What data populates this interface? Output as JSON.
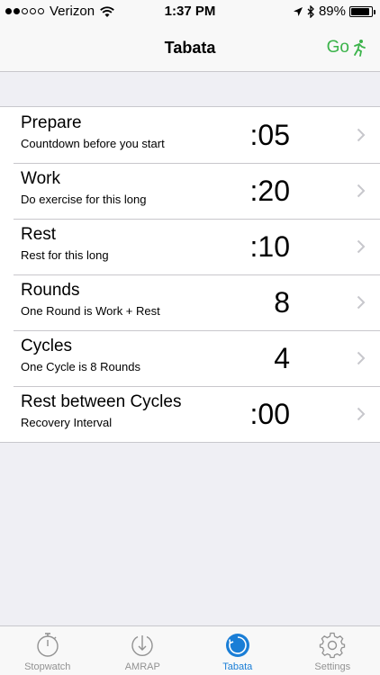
{
  "status_bar": {
    "carrier": "Verizon",
    "time": "1:37 PM",
    "battery": "89%",
    "battery_level": 0.89,
    "signal_bars_filled": 2,
    "signal_bars_total": 5
  },
  "nav": {
    "title": "Tabata",
    "go_label": "Go",
    "go_icon": "running-person-icon",
    "accent_color": "#3bb34a"
  },
  "settings": [
    {
      "title": "Prepare",
      "subtitle": "Countdown before you start",
      "value": ":05"
    },
    {
      "title": "Work",
      "subtitle": "Do exercise for this long",
      "value": ":20"
    },
    {
      "title": "Rest",
      "subtitle": "Rest for this long",
      "value": ":10"
    },
    {
      "title": "Rounds",
      "subtitle": "One Round is Work + Rest",
      "value": "8"
    },
    {
      "title": "Cycles",
      "subtitle": "One Cycle is 8 Rounds",
      "value": "4"
    },
    {
      "title": "Rest between Cycles",
      "subtitle": "Recovery Interval",
      "value": ":00"
    }
  ],
  "tabs": [
    {
      "label": "Stopwatch",
      "icon": "stopwatch-icon",
      "active": false
    },
    {
      "label": "AMRAP",
      "icon": "amrap-icon",
      "active": false
    },
    {
      "label": "Tabata",
      "icon": "tabata-icon",
      "active": true
    },
    {
      "label": "Settings",
      "icon": "gear-icon",
      "active": false
    }
  ],
  "colors": {
    "tab_active": "#1a7ed6",
    "tab_inactive": "#929292"
  }
}
